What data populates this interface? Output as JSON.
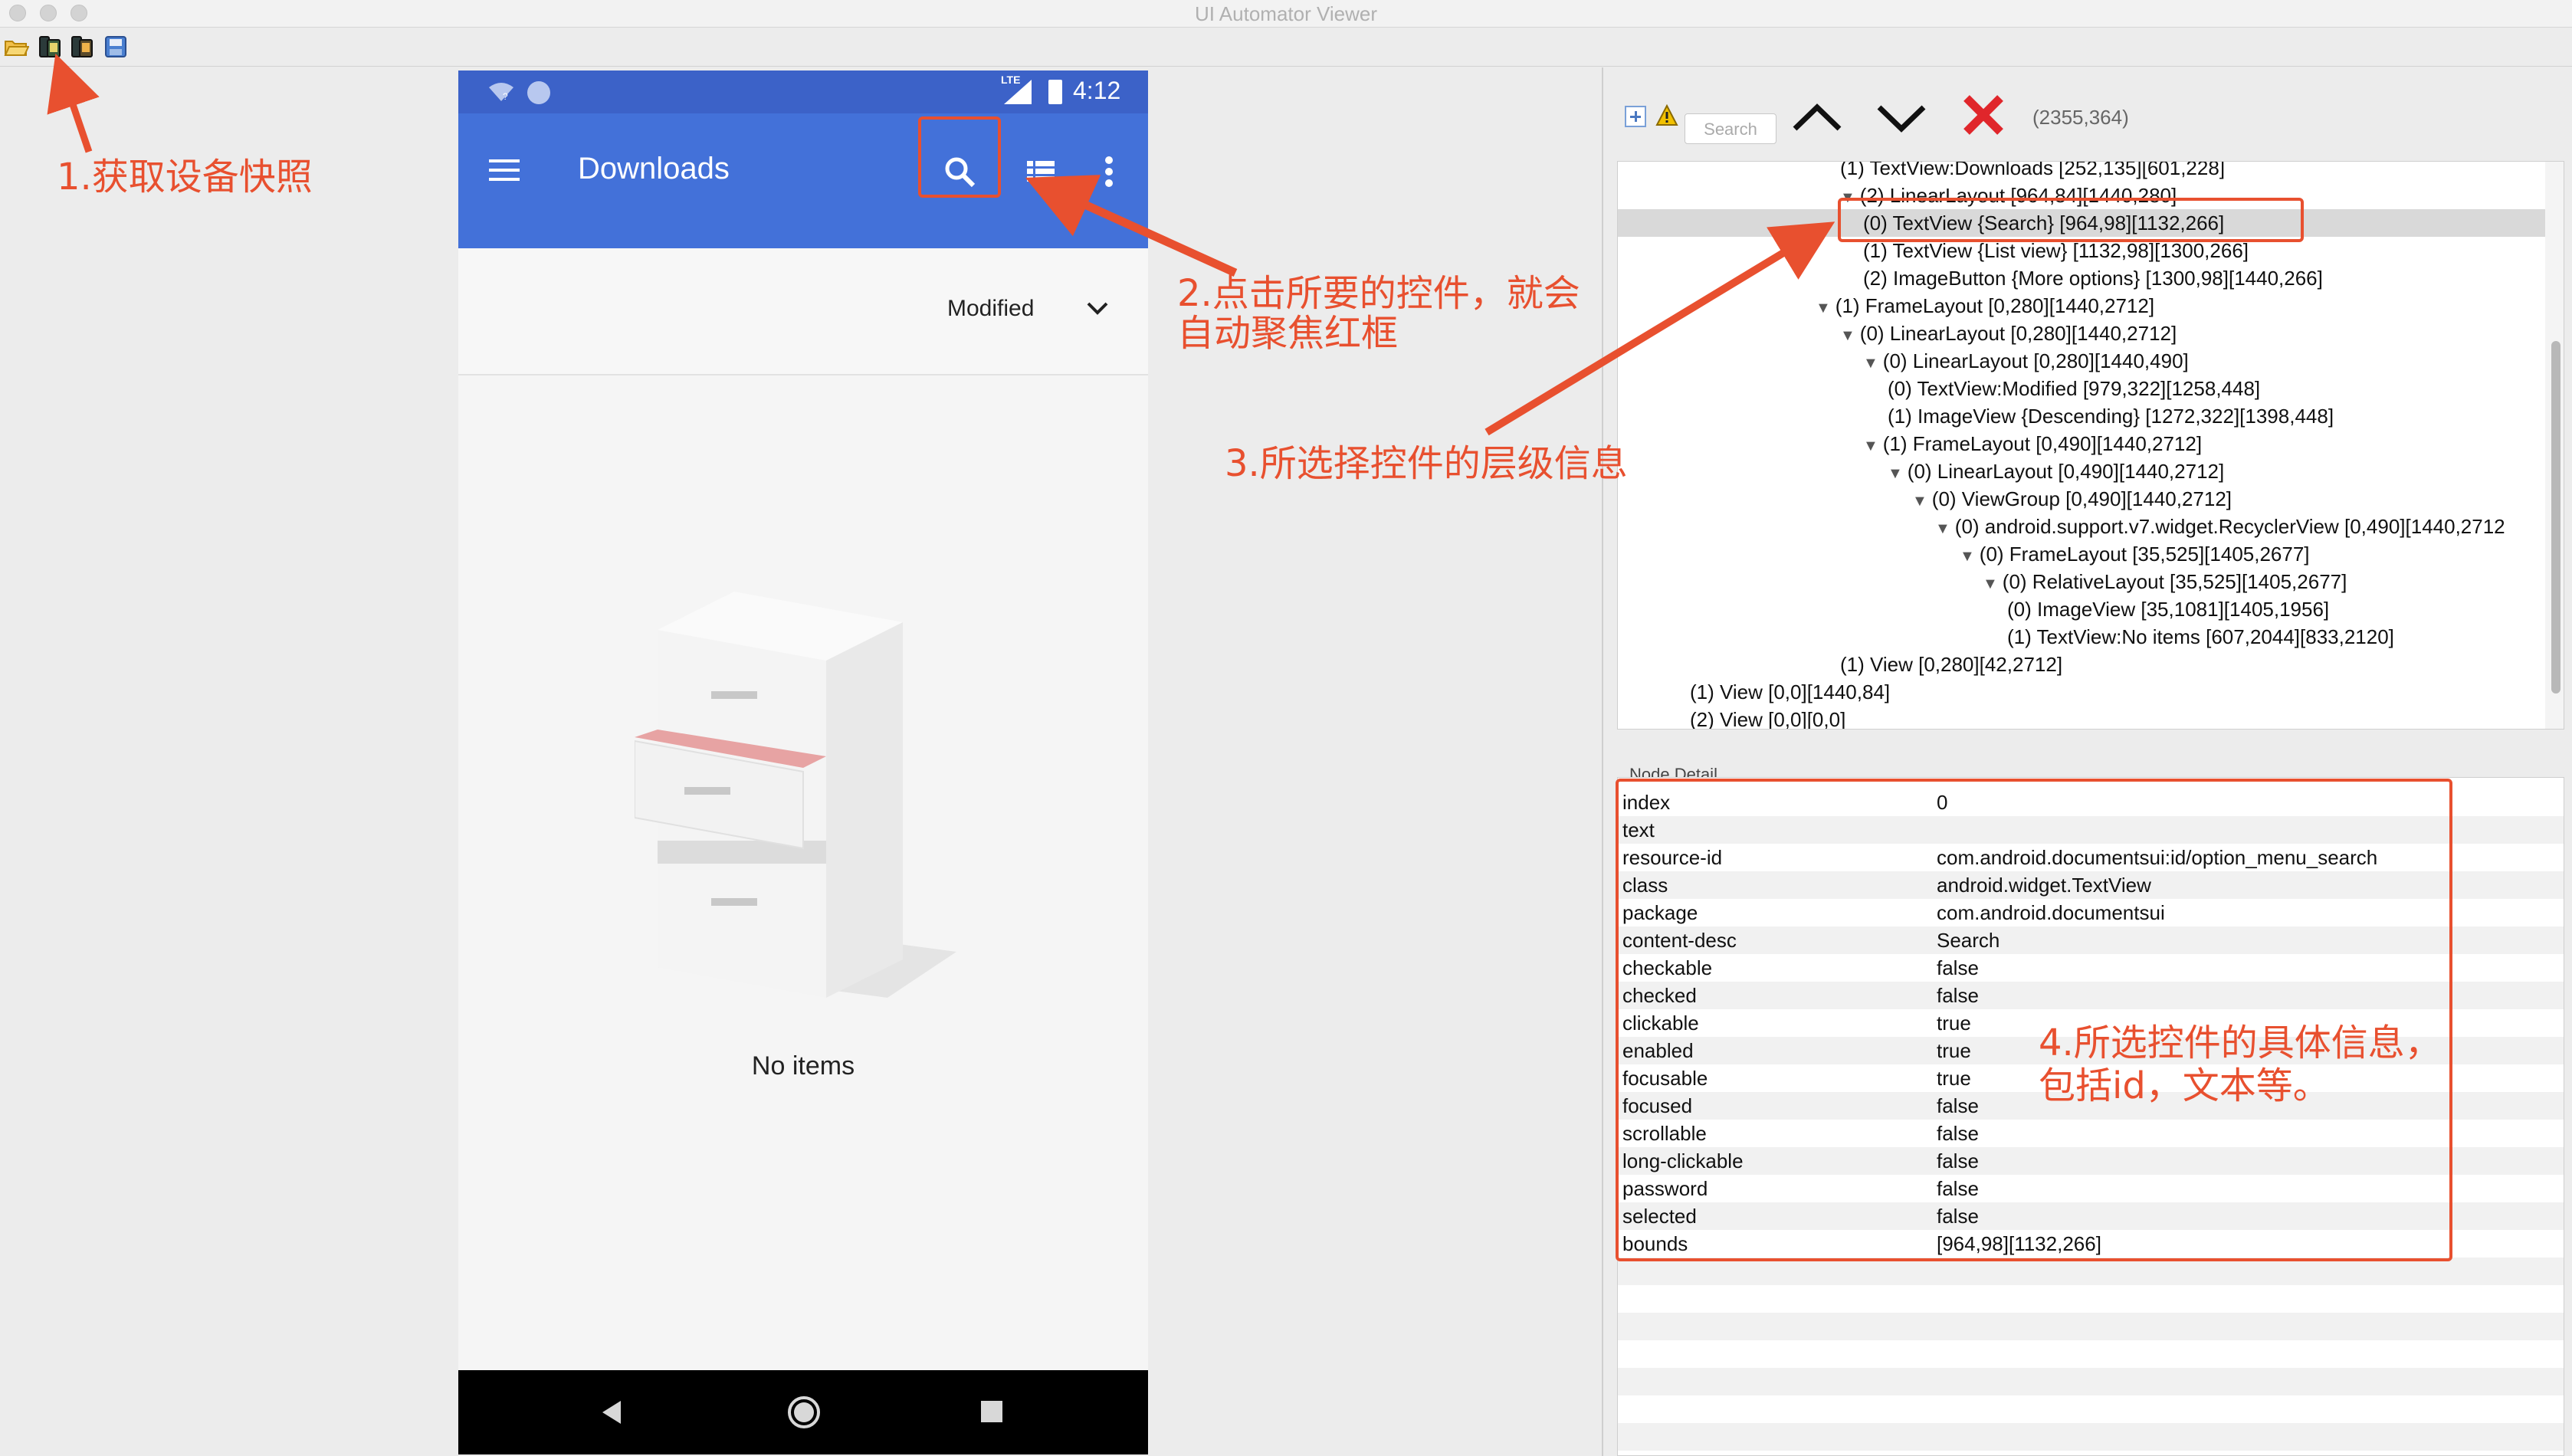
{
  "window": {
    "title": "UI Automator Viewer"
  },
  "toolbar": {
    "buttons": [
      {
        "icon": "open-folder-icon"
      },
      {
        "icon": "device-screenshot-icon"
      },
      {
        "icon": "device-screenshot-compressed-icon"
      },
      {
        "icon": "save-icon"
      }
    ]
  },
  "device": {
    "status": {
      "network": "LTE",
      "time": "4:12"
    },
    "appbar": {
      "title": "Downloads",
      "menu_icon": "hamburger-menu-icon",
      "search_icon": "search-icon",
      "list_icon": "list-view-icon",
      "more_icon": "more-options-icon"
    },
    "sort": {
      "label": "Modified",
      "icon": "chevron-down-icon"
    },
    "empty_text": "No items"
  },
  "tree_toolbar": {
    "search_placeholder": "Search",
    "coords": "(2355,364)"
  },
  "tree": [
    {
      "text": "(1) TextView:Downloads [252,135][601,228]",
      "arrow": ""
    },
    {
      "text": "(2) LinearLayout [964,84][1440,280]",
      "arrow": "▼"
    },
    {
      "text": "(0) TextView {Search} [964,98][1132,266]",
      "arrow": "",
      "selected": true
    },
    {
      "text": "(1) TextView {List view} [1132,98][1300,266]",
      "arrow": ""
    },
    {
      "text": "(2) ImageButton {More options} [1300,98][1440,266]",
      "arrow": ""
    },
    {
      "text": "(1) FrameLayout [0,280][1440,2712]",
      "arrow": "▼"
    },
    {
      "text": "(0) LinearLayout [0,280][1440,2712]",
      "arrow": "▼"
    },
    {
      "text": "(0) LinearLayout [0,280][1440,490]",
      "arrow": "▼"
    },
    {
      "text": "(0) TextView:Modified [979,322][1258,448]",
      "arrow": ""
    },
    {
      "text": "(1) ImageView {Descending} [1272,322][1398,448]",
      "arrow": ""
    },
    {
      "text": "(1) FrameLayout [0,490][1440,2712]",
      "arrow": "▼"
    },
    {
      "text": "(0) LinearLayout [0,490][1440,2712]",
      "arrow": "▼"
    },
    {
      "text": "(0) ViewGroup [0,490][1440,2712]",
      "arrow": "▼"
    },
    {
      "text": "(0) android.support.v7.widget.RecyclerView [0,490][1440,2712",
      "arrow": "▼"
    },
    {
      "text": "(0) FrameLayout [35,525][1405,2677]",
      "arrow": "▼"
    },
    {
      "text": "(0) RelativeLayout [35,525][1405,2677]",
      "arrow": "▼"
    },
    {
      "text": "(0) ImageView [35,1081][1405,1956]",
      "arrow": ""
    },
    {
      "text": "(1) TextView:No items [607,2044][833,2120]",
      "arrow": ""
    },
    {
      "text": "(1) View [0,280][42,2712]",
      "arrow": ""
    },
    {
      "text": "(1) View [0,0][1440,84]",
      "arrow": ""
    },
    {
      "text": "(2) View [0,0][0,0]",
      "arrow": ""
    }
  ],
  "detail": {
    "title": "Node Detail",
    "rows": [
      {
        "key": "index",
        "value": "0"
      },
      {
        "key": "text",
        "value": ""
      },
      {
        "key": "resource-id",
        "value": "com.android.documentsui:id/option_menu_search"
      },
      {
        "key": "class",
        "value": "android.widget.TextView"
      },
      {
        "key": "package",
        "value": "com.android.documentsui"
      },
      {
        "key": "content-desc",
        "value": "Search"
      },
      {
        "key": "checkable",
        "value": "false"
      },
      {
        "key": "checked",
        "value": "false"
      },
      {
        "key": "clickable",
        "value": "true"
      },
      {
        "key": "enabled",
        "value": "true"
      },
      {
        "key": "focusable",
        "value": "true"
      },
      {
        "key": "focused",
        "value": "false"
      },
      {
        "key": "scrollable",
        "value": "false"
      },
      {
        "key": "long-clickable",
        "value": "false"
      },
      {
        "key": "password",
        "value": "false"
      },
      {
        "key": "selected",
        "value": "false"
      },
      {
        "key": "bounds",
        "value": "[964,98][1132,266]"
      }
    ]
  },
  "annotations": {
    "a1": "1.获取设备快照",
    "a2_line1": "2.点击所要的控件，就会",
    "a2_line2": "自动聚焦红框",
    "a3": "3.所选择控件的层级信息",
    "a4_line1": "4.所选控件的具体信息，",
    "a4_line2": "包括id，文本等。"
  },
  "colors": {
    "annotation": "#e8502f",
    "appbar": "#4371d9",
    "statusbar": "#3c62c8"
  }
}
